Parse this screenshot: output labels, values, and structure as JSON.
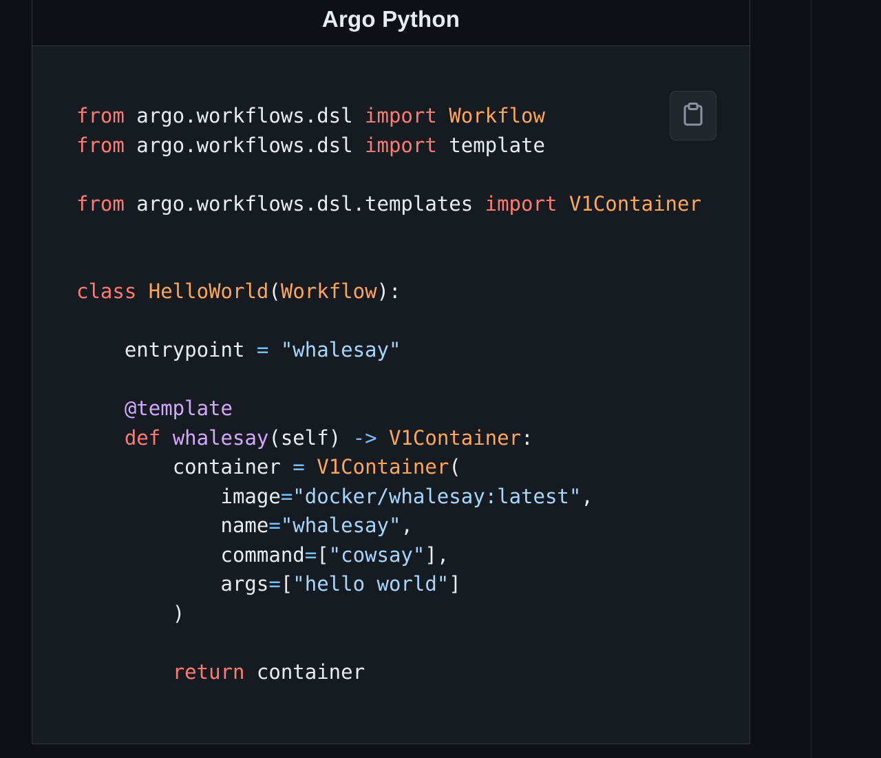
{
  "header": {
    "title": "Argo Python"
  },
  "copy_button": {
    "icon": "clipboard-icon"
  },
  "code": {
    "language": "python",
    "lines": [
      {
        "indent": "",
        "tokens": [
          {
            "t": "from",
            "c": "kw"
          },
          {
            "t": " argo.workflows.dsl ",
            "c": ""
          },
          {
            "t": "import",
            "c": "kw"
          },
          {
            "t": " ",
            "c": ""
          },
          {
            "t": "Workflow",
            "c": "cls"
          }
        ]
      },
      {
        "indent": "",
        "tokens": [
          {
            "t": "from",
            "c": "kw"
          },
          {
            "t": " argo.workflows.dsl ",
            "c": ""
          },
          {
            "t": "import",
            "c": "kw"
          },
          {
            "t": " template",
            "c": ""
          }
        ]
      },
      {
        "indent": "",
        "tokens": []
      },
      {
        "indent": "",
        "tokens": [
          {
            "t": "from",
            "c": "kw"
          },
          {
            "t": " argo.workflows.dsl.templates ",
            "c": ""
          },
          {
            "t": "import",
            "c": "kw"
          },
          {
            "t": " ",
            "c": ""
          },
          {
            "t": "V1Container",
            "c": "cls"
          }
        ]
      },
      {
        "indent": "",
        "tokens": []
      },
      {
        "indent": "",
        "tokens": []
      },
      {
        "indent": "",
        "tokens": [
          {
            "t": "class",
            "c": "kw"
          },
          {
            "t": " ",
            "c": ""
          },
          {
            "t": "HelloWorld",
            "c": "cls"
          },
          {
            "t": "(",
            "c": ""
          },
          {
            "t": "Workflow",
            "c": "cls"
          },
          {
            "t": "):",
            "c": ""
          }
        ]
      },
      {
        "indent": "",
        "tokens": []
      },
      {
        "indent": "    ",
        "tokens": [
          {
            "t": "entrypoint ",
            "c": ""
          },
          {
            "t": "=",
            "c": "op"
          },
          {
            "t": " ",
            "c": ""
          },
          {
            "t": "\"whalesay\"",
            "c": "str"
          }
        ]
      },
      {
        "indent": "",
        "tokens": []
      },
      {
        "indent": "    ",
        "tokens": [
          {
            "t": "@template",
            "c": "fn"
          }
        ]
      },
      {
        "indent": "    ",
        "tokens": [
          {
            "t": "def",
            "c": "kw"
          },
          {
            "t": " ",
            "c": ""
          },
          {
            "t": "whalesay",
            "c": "fn"
          },
          {
            "t": "(self) ",
            "c": ""
          },
          {
            "t": "->",
            "c": "op"
          },
          {
            "t": " ",
            "c": ""
          },
          {
            "t": "V1Container",
            "c": "cls"
          },
          {
            "t": ":",
            "c": ""
          }
        ]
      },
      {
        "indent": "        ",
        "tokens": [
          {
            "t": "container ",
            "c": ""
          },
          {
            "t": "=",
            "c": "op"
          },
          {
            "t": " ",
            "c": ""
          },
          {
            "t": "V1Container",
            "c": "cls"
          },
          {
            "t": "(",
            "c": ""
          }
        ]
      },
      {
        "indent": "            ",
        "tokens": [
          {
            "t": "image",
            "c": ""
          },
          {
            "t": "=",
            "c": "op"
          },
          {
            "t": "\"docker/whalesay:latest\"",
            "c": "str"
          },
          {
            "t": ",",
            "c": ""
          }
        ]
      },
      {
        "indent": "            ",
        "tokens": [
          {
            "t": "name",
            "c": ""
          },
          {
            "t": "=",
            "c": "op"
          },
          {
            "t": "\"whalesay\"",
            "c": "str"
          },
          {
            "t": ",",
            "c": ""
          }
        ]
      },
      {
        "indent": "            ",
        "tokens": [
          {
            "t": "command",
            "c": ""
          },
          {
            "t": "=",
            "c": "op"
          },
          {
            "t": "[",
            "c": ""
          },
          {
            "t": "\"cowsay\"",
            "c": "str"
          },
          {
            "t": "],",
            "c": ""
          }
        ]
      },
      {
        "indent": "            ",
        "tokens": [
          {
            "t": "args",
            "c": ""
          },
          {
            "t": "=",
            "c": "op"
          },
          {
            "t": "[",
            "c": ""
          },
          {
            "t": "\"hello world\"",
            "c": "str"
          },
          {
            "t": "]",
            "c": ""
          }
        ]
      },
      {
        "indent": "        ",
        "tokens": [
          {
            "t": ")",
            "c": ""
          }
        ]
      },
      {
        "indent": "",
        "tokens": []
      },
      {
        "indent": "        ",
        "tokens": [
          {
            "t": "return",
            "c": "kw"
          },
          {
            "t": " container",
            "c": ""
          }
        ]
      }
    ]
  },
  "colors": {
    "background": "#0d1117",
    "code_background": "#161b22",
    "border": "#30363d",
    "keyword": "#ff7b72",
    "class_name": "#ffa657",
    "string": "#a5d6ff",
    "function": "#d2a8ff",
    "operator": "#79c0ff",
    "text": "#e6edf3"
  }
}
